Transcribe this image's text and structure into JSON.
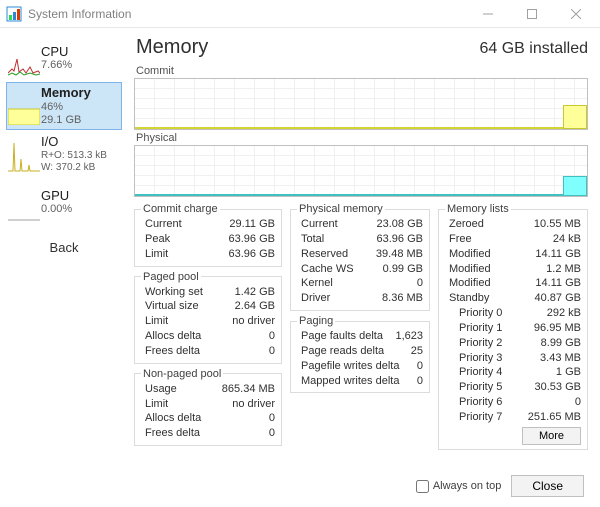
{
  "window": {
    "title": "System Information"
  },
  "sidebar": {
    "items": [
      {
        "title": "CPU",
        "sub1": "7.66%",
        "sub2": ""
      },
      {
        "title": "Memory",
        "sub1": "46%",
        "sub2": "29.1 GB"
      },
      {
        "title": "I/O",
        "sub1": "R+O: 513.3 kB",
        "sub2": "W: 370.2 kB"
      },
      {
        "title": "GPU",
        "sub1": "0.00%",
        "sub2": ""
      }
    ],
    "back": "Back"
  },
  "header": {
    "title": "Memory",
    "installed": "64 GB installed"
  },
  "chart_labels": {
    "commit": "Commit",
    "physical": "Physical"
  },
  "commit_charge": {
    "legend": "Commit charge",
    "rows": [
      [
        "Current",
        "29.11 GB"
      ],
      [
        "Peak",
        "63.96 GB"
      ],
      [
        "Limit",
        "63.96 GB"
      ]
    ]
  },
  "paged_pool": {
    "legend": "Paged pool",
    "rows": [
      [
        "Working set",
        "1.42 GB"
      ],
      [
        "Virtual size",
        "2.64 GB"
      ],
      [
        "Limit",
        "no driver"
      ],
      [
        "Allocs delta",
        "0"
      ],
      [
        "Frees delta",
        "0"
      ]
    ]
  },
  "nonpaged_pool": {
    "legend": "Non-paged pool",
    "rows": [
      [
        "Usage",
        "865.34 MB"
      ],
      [
        "Limit",
        "no driver"
      ],
      [
        "Allocs delta",
        "0"
      ],
      [
        "Frees delta",
        "0"
      ]
    ]
  },
  "physical_memory": {
    "legend": "Physical memory",
    "rows": [
      [
        "Current",
        "23.08 GB"
      ],
      [
        "Total",
        "63.96 GB"
      ],
      [
        "Reserved",
        "39.48 MB"
      ],
      [
        "Cache WS",
        "0.99 GB"
      ],
      [
        "Kernel",
        "0"
      ],
      [
        "Driver",
        "8.36 MB"
      ]
    ]
  },
  "paging": {
    "legend": "Paging",
    "rows": [
      [
        "Page faults delta",
        "1,623"
      ],
      [
        "Page reads delta",
        "25"
      ],
      [
        "Pagefile writes delta",
        "0"
      ],
      [
        "Mapped writes delta",
        "0"
      ]
    ]
  },
  "memory_lists": {
    "legend": "Memory lists",
    "rows": [
      [
        "Zeroed",
        "10.55 MB"
      ],
      [
        "Free",
        "24 kB"
      ],
      [
        "Modified",
        "14.11 GB"
      ],
      [
        "Modified",
        "1.2 MB"
      ],
      [
        "Modified",
        "14.11 GB"
      ],
      [
        "Standby",
        "40.87 GB"
      ],
      [
        "Priority 0",
        "292 kB"
      ],
      [
        "Priority 1",
        "96.95 MB"
      ],
      [
        "Priority 2",
        "8.99 GB"
      ],
      [
        "Priority 3",
        "3.43 MB"
      ],
      [
        "Priority 4",
        "1 GB"
      ],
      [
        "Priority 5",
        "30.53 GB"
      ],
      [
        "Priority 6",
        "0"
      ],
      [
        "Priority 7",
        "251.65 MB"
      ]
    ],
    "more": "More"
  },
  "footer": {
    "always_on_top": "Always on top",
    "close": "Close"
  },
  "colors": {
    "selection": "#cde6f7",
    "commit_fill": "#ffff99",
    "physical_fill": "#80ffff"
  },
  "chart_data": [
    {
      "type": "area",
      "name": "Commit",
      "ylim": [
        0,
        64
      ],
      "unit": "GB",
      "series": [
        {
          "name": "Commit",
          "values_recent_pct": 46
        }
      ]
    },
    {
      "type": "area",
      "name": "Physical",
      "ylim": [
        0,
        64
      ],
      "unit": "GB",
      "series": [
        {
          "name": "Physical",
          "values_recent_pct": 36
        }
      ]
    }
  ]
}
